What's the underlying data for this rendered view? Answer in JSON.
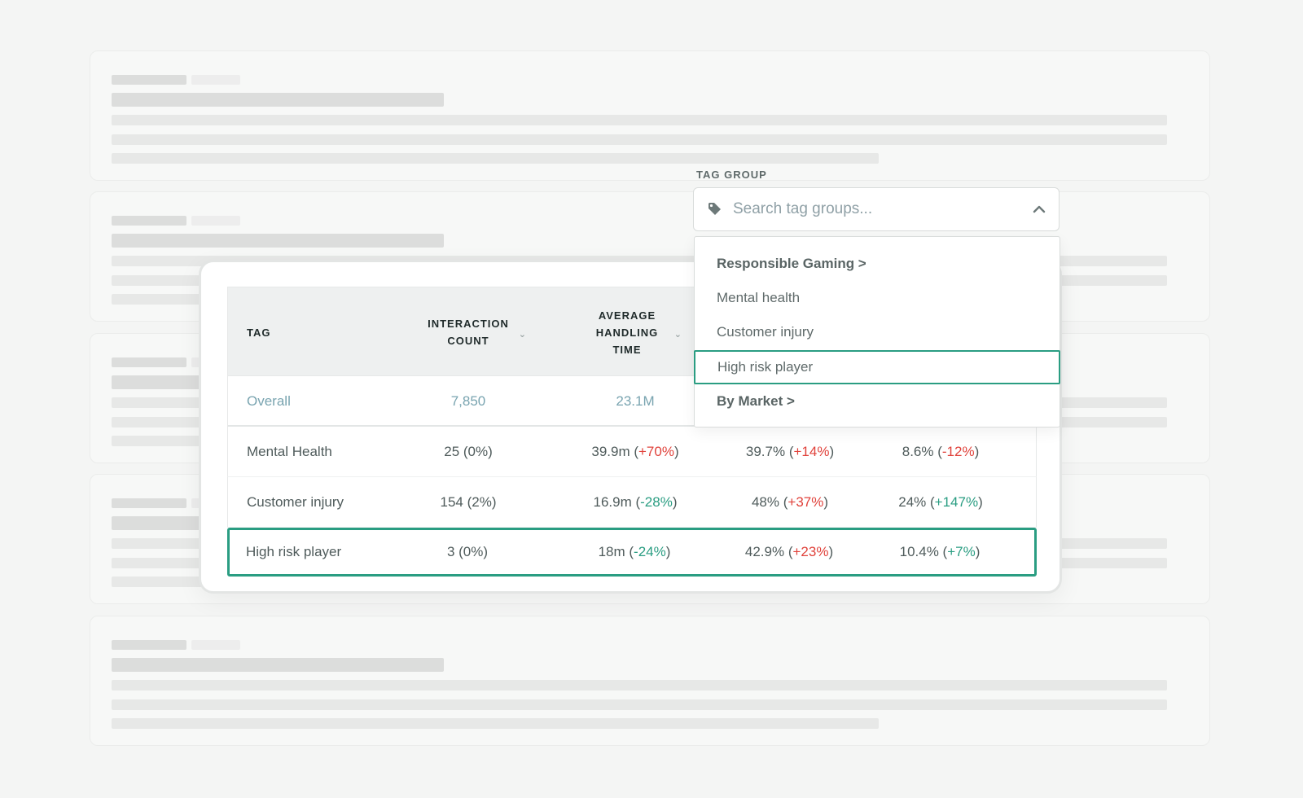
{
  "dropdown": {
    "label": "TAG GROUP",
    "placeholder": "Search tag groups...",
    "items": [
      {
        "label": "Responsible Gaming >",
        "kind": "group"
      },
      {
        "label": "Mental health",
        "kind": "option"
      },
      {
        "label": "Customer injury",
        "kind": "option"
      },
      {
        "label": "High risk player",
        "kind": "option",
        "selected": true
      },
      {
        "label": "By Market >",
        "kind": "group"
      }
    ]
  },
  "table": {
    "headers": {
      "tag": "TAG",
      "interaction_count_1": "INTERACTION",
      "interaction_count_2": "COUNT",
      "aht_1": "AVERAGE",
      "aht_2": "HANDLING",
      "aht_3": "TIME"
    },
    "overall": {
      "tag": "Overall",
      "count": "7,850",
      "aht": "23.1M"
    },
    "rows": [
      {
        "tag": "Mental Health",
        "count": "25 (0%)",
        "aht_val": "39.9m (",
        "aht_delta": "+70%",
        "aht_end": ")",
        "c4_val": "39.7% (",
        "c4_delta": "+14%",
        "c4_end": ")",
        "c5_val": "8.6% (",
        "c5_delta": "-12%",
        "c5_end": ")"
      },
      {
        "tag": "Customer injury",
        "count": "154 (2%)",
        "aht_val": "16.9m (",
        "aht_delta": "-28%",
        "aht_end": ")",
        "c4_val": "48% (",
        "c4_delta": "+37%",
        "c4_end": ")",
        "c5_val": "24% (",
        "c5_delta": "+147%",
        "c5_end": ")"
      },
      {
        "tag": "High risk player",
        "count": "3 (0%)",
        "aht_val": "18m (",
        "aht_delta": "-24%",
        "aht_end": ")",
        "c4_val": "42.9% (",
        "c4_delta": "+23%",
        "c4_end": ")",
        "c5_val": "10.4% (",
        "c5_delta": "+7%",
        "c5_end": ")"
      }
    ]
  },
  "colors": {
    "accent": "#2a9d82",
    "increase": "#e0423b",
    "decrease": "#2a9d82",
    "overall_text": "#79a4b0"
  },
  "icons": {
    "tag": "tag-icon",
    "chevron_up": "chevron-up-icon",
    "sort": "chevron-down-icon"
  }
}
